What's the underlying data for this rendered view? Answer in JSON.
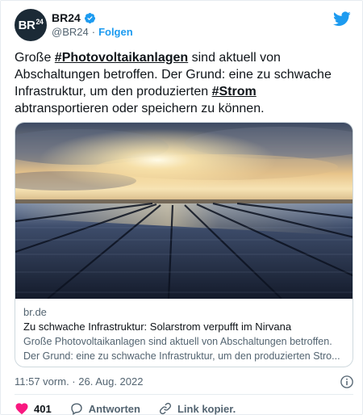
{
  "author": {
    "avatar_text": "BR",
    "avatar_sup": "24",
    "display_name": "BR24",
    "handle": "@BR24",
    "separator": "·",
    "follow_label": "Folgen"
  },
  "tweet": {
    "t1": "Große ",
    "h1": "#Photovoltaikanlagen",
    "t2": " sind aktuell von Abschaltungen betroffen. Der Grund: eine zu schwache Infrastruktur, um den produzierten ",
    "h2": "#Strom",
    "t3": " abtransportieren oder speichern zu können."
  },
  "link_card": {
    "domain": "br.de",
    "title": "Zu schwache Infrastruktur: Solarstrom verpufft im Nirvana",
    "desc1": "Große Photovoltaikanlagen sind aktuell von Abschaltungen betroffen.",
    "desc2": "Der Grund: eine zu schwache Infrastruktur, um den produzierten Stro..."
  },
  "meta": {
    "time": "11:57 vorm. · 26. Aug. 2022"
  },
  "actions": {
    "likes": "401",
    "reply_label": "Antworten",
    "copy_label": "Link kopier."
  },
  "colors": {
    "accent": "#1d9bf0",
    "like": "#f91880",
    "avatar_bg": "#1b2a36"
  }
}
